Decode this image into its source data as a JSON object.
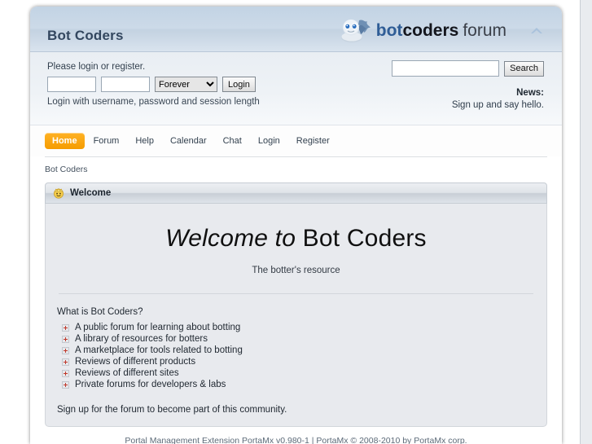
{
  "header": {
    "site_title": "Bot Coders",
    "logo_bot": "bot",
    "logo_coders": "coders",
    "logo_forum": "forum",
    "collapse_icon": "chevron-up-icon",
    "mascot_icon": "robot-mascot-icon"
  },
  "login": {
    "prompt": "Please login or register.",
    "username_value": "",
    "username_placeholder": "",
    "password_value": "",
    "password_placeholder": "",
    "session_selected": "Forever",
    "session_options": [
      "Forever"
    ],
    "login_button": "Login",
    "hint": "Login with username, password and session length"
  },
  "search": {
    "value": "",
    "placeholder": "",
    "button": "Search",
    "news_label": "News:",
    "news_text": "Sign up and say hello."
  },
  "nav": {
    "items": [
      {
        "label": "Home",
        "active": true
      },
      {
        "label": "Forum",
        "active": false
      },
      {
        "label": "Help",
        "active": false
      },
      {
        "label": "Calendar",
        "active": false
      },
      {
        "label": "Chat",
        "active": false
      },
      {
        "label": "Login",
        "active": false
      },
      {
        "label": "Register",
        "active": false
      }
    ]
  },
  "breadcrumb": "Bot Coders",
  "panel": {
    "icon": "smiley-icon",
    "title": "Welcome",
    "hero_title_italic": "Welcome to",
    "hero_title_rest": "Bot Coders",
    "hero_subtitle": "The botter's resource",
    "question": "What is Bot Coders?",
    "features": [
      "A public forum for learning about botting",
      "A library of resources for botters",
      "A marketplace for tools related to botting",
      "Reviews of different products",
      "Reviews of different sites",
      "Private forums for developers & labs"
    ],
    "signup": "Sign up for the forum to become part of this community."
  },
  "footer": {
    "text": "Portal Management Extension PortaMx v0.980-1 | PortaMx © 2008-2010 by PortaMx corp."
  },
  "colors": {
    "accent_orange": "#f59c00",
    "header_blue": "#c6d5e5",
    "page_bg": "#446c91",
    "logo_blue": "#2f5d96"
  }
}
